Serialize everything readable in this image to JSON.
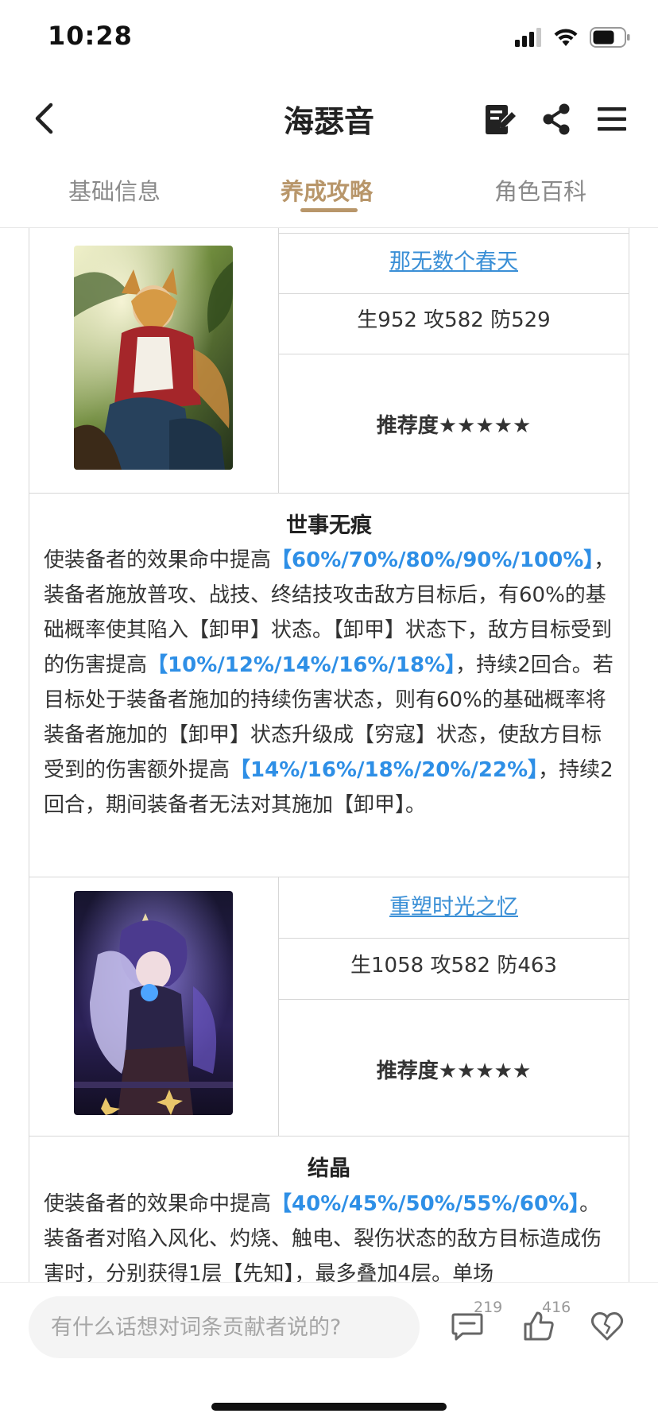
{
  "status_bar": {
    "time": "10:28",
    "icons": [
      "signal-icon",
      "wifi-icon",
      "battery-icon"
    ]
  },
  "header": {
    "title": "海瑟音",
    "icons": [
      "back-icon",
      "edit-icon",
      "share-icon",
      "menu-icon"
    ]
  },
  "tabs": [
    {
      "label": "基础信息",
      "active": false
    },
    {
      "label": "养成攻略",
      "active": true
    },
    {
      "label": "角色百科",
      "active": false
    }
  ],
  "light_cones": [
    {
      "name": "那无数个春天",
      "stats": "生952  攻582  防529",
      "rating": "推荐度★★★★★",
      "skill_title": "世事无痕",
      "desc": [
        {
          "t": "使装备者的效果命中提高",
          "h": false
        },
        {
          "t": "【60%/70%/80%/90%/100%】",
          "h": true
        },
        {
          "t": "，装备者施放普攻、战技、终结技攻击敌方目标后，有60%的基础概率使其陷入【卸甲】状态。【卸甲】状态下，敌方目标受到的伤害提高",
          "h": false
        },
        {
          "t": "【10%/12%/14%/16%/18%】",
          "h": true
        },
        {
          "t": "，持续2回合。若目标处于装备者施加的持续伤害状态，则有60%的基础概率将装备者施加的【卸甲】状态升级成【穷寇】状态，使敌方目标受到的伤害额外提高",
          "h": false
        },
        {
          "t": "【14%/16%/18%/20%/22%】",
          "h": true
        },
        {
          "t": "，持续2回合，期间装备者无法对其施加【卸甲】。",
          "h": false
        }
      ]
    },
    {
      "name": "重塑时光之忆",
      "stats": "生1058  攻582  防463",
      "rating": "推荐度★★★★★",
      "skill_title": "结晶",
      "desc": [
        {
          "t": "使装备者的效果命中提高",
          "h": false
        },
        {
          "t": "【40%/45%/50%/55%/60%】",
          "h": true
        },
        {
          "t": "。装备者对陷入风化、灼烧、触电、裂伤状态的敌方目标造成伤害时，分别获得1层【先知】，最多叠加4层。单场",
          "h": false
        }
      ]
    }
  ],
  "bottom_bar": {
    "placeholder": "有什么话想对词条贡献者说的?",
    "comment_count": "219",
    "like_count": "416",
    "icons": [
      "comment-icon",
      "like-icon",
      "heart-icon"
    ]
  },
  "colors": {
    "accent": "#b8966a",
    "link": "#3a8fd6",
    "highlight": "#2e8fe6"
  }
}
